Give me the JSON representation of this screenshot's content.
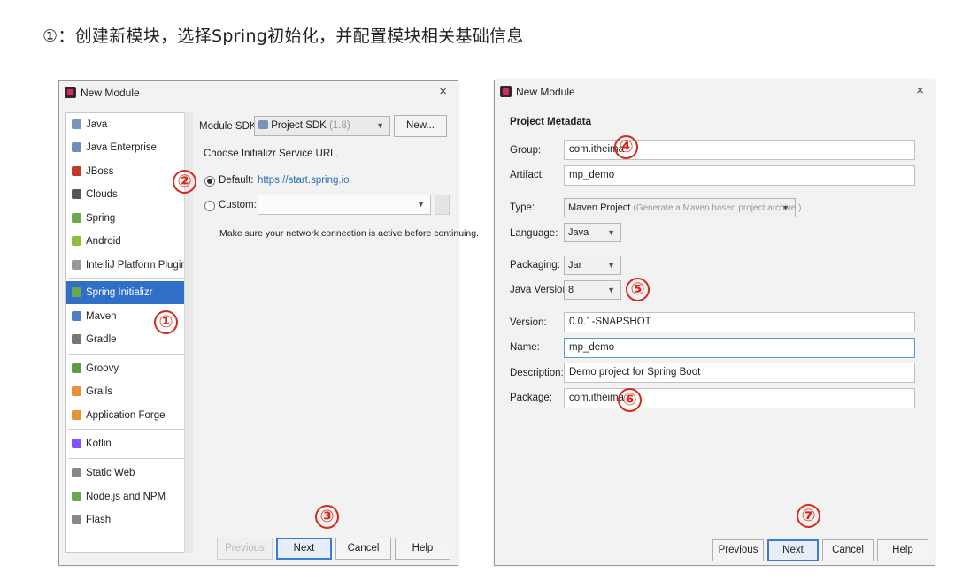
{
  "heading": "①：创建新模块，选择Spring初始化，并配置模块相关基础信息",
  "left_dialog": {
    "title": "New Module",
    "close": "×",
    "sidebar": [
      {
        "label": "Java",
        "icon": "folder-icon",
        "color": "#7a93b8"
      },
      {
        "label": "Java Enterprise",
        "icon": "enterprise-icon",
        "color": "#6c8fbf"
      },
      {
        "label": "JBoss",
        "icon": "jboss-icon",
        "color": "#c0392b"
      },
      {
        "label": "Clouds",
        "icon": "clouds-icon",
        "color": "#555555"
      },
      {
        "label": "Spring",
        "icon": "spring-leaf-icon",
        "color": "#6aa84f"
      },
      {
        "label": "Android",
        "icon": "android-icon",
        "color": "#8bbf3f"
      },
      {
        "label": "IntelliJ Platform Plugin",
        "icon": "plugin-icon",
        "color": "#999999"
      },
      {
        "label": "Spring Initializr",
        "icon": "spring-initializr-icon",
        "color": "#6aa84f"
      },
      {
        "label": "Maven",
        "icon": "maven-icon",
        "color": "#4a7fc1"
      },
      {
        "label": "Gradle",
        "icon": "gradle-icon",
        "color": "#777777"
      },
      {
        "label": "Groovy",
        "icon": "groovy-icon",
        "color": "#5d9c3f"
      },
      {
        "label": "Grails",
        "icon": "grails-icon",
        "color": "#e69138"
      },
      {
        "label": "Application Forge",
        "icon": "forge-icon",
        "color": "#e69138"
      },
      {
        "label": "Kotlin",
        "icon": "kotlin-icon",
        "color": "#7f52ff"
      },
      {
        "label": "Static Web",
        "icon": "web-icon",
        "color": "#888888"
      },
      {
        "label": "Node.js and NPM",
        "icon": "nodejs-icon",
        "color": "#6aa84f"
      },
      {
        "label": "Flash",
        "icon": "flash-icon",
        "color": "#888888"
      }
    ],
    "module_sdk_label": "Module SDK:",
    "sdk_value": "Project SDK",
    "sdk_version": "(1.8)",
    "new_button": "New...",
    "choose_url_label": "Choose Initializr Service URL.",
    "default_label": "Default:",
    "default_url": "https://start.spring.io",
    "custom_label": "Custom:",
    "network_note": "Make sure your network connection is active before continuing.",
    "buttons": {
      "previous": "Previous",
      "next": "Next",
      "cancel": "Cancel",
      "help": "Help"
    }
  },
  "right_dialog": {
    "title": "New Module",
    "close": "×",
    "section_title": "Project Metadata",
    "fields": {
      "group": {
        "label": "Group:",
        "value": "com.itheima"
      },
      "artifact": {
        "label": "Artifact:",
        "value": "mp_demo"
      },
      "type": {
        "label": "Type:",
        "value": "Maven Project",
        "hint": "(Generate a Maven based project archive.)"
      },
      "language": {
        "label": "Language:",
        "value": "Java"
      },
      "packaging": {
        "label": "Packaging:",
        "value": "Jar"
      },
      "java_version": {
        "label": "Java Version:",
        "value": "8"
      },
      "version": {
        "label": "Version:",
        "value": "0.0.1-SNAPSHOT"
      },
      "name": {
        "label": "Name:",
        "value": "mp_demo"
      },
      "description": {
        "label": "Description:",
        "value": "Demo project for Spring Boot"
      },
      "package": {
        "label": "Package:",
        "value": "com.itheima"
      }
    },
    "buttons": {
      "previous": "Previous",
      "next": "Next",
      "cancel": "Cancel",
      "help": "Help"
    }
  },
  "annotations": [
    "①",
    "②",
    "③",
    "④",
    "⑤",
    "⑥",
    "⑦"
  ],
  "colors": {
    "annotation_red": "#d42a1c",
    "selection_blue": "#2f6fc8",
    "link_blue": "#2a6fb8"
  }
}
